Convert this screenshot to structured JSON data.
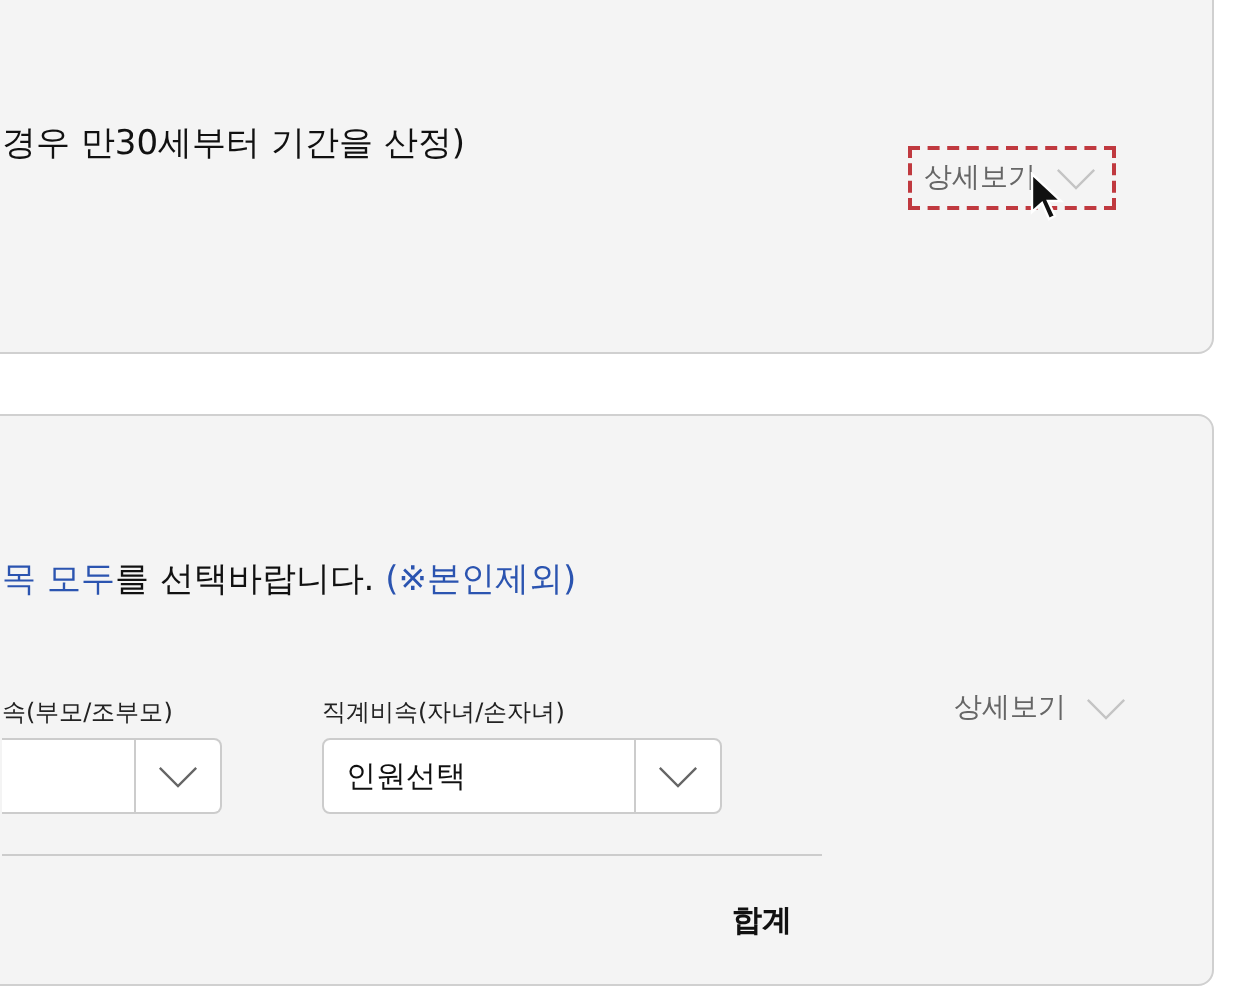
{
  "period_card": {
    "note": "경우 만30세부터 기간을 산정)",
    "detail_toggle": {
      "label": "상세보기",
      "expanded": false,
      "focused": true
    }
  },
  "family_card": {
    "instruction": [
      {
        "text": "목 모두",
        "emphasis": true
      },
      {
        "text": "를 선택바랍니다. ",
        "emphasis": false
      },
      {
        "text": "(※본인제외)",
        "emphasis": true
      }
    ],
    "selects": [
      {
        "label": "속(부모/조부모)"
      },
      {
        "label": "직계비속(자녀/손자녀)",
        "value": "인원선택"
      }
    ],
    "total_label": "합계",
    "detail_toggle": {
      "label": "상세보기",
      "expanded": false,
      "focused": false
    }
  }
}
